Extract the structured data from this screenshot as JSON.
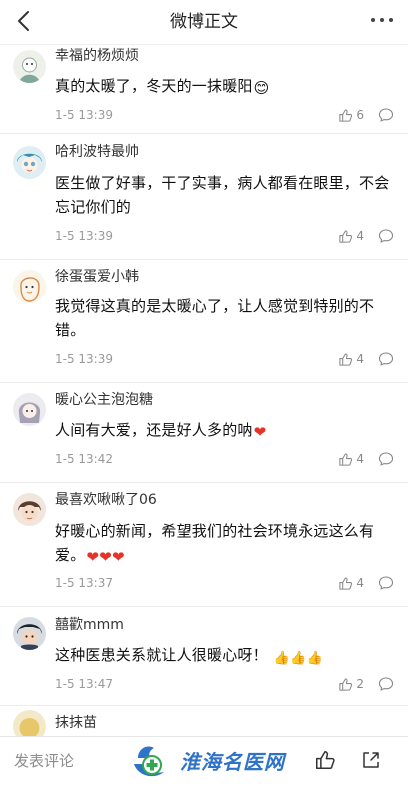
{
  "header": {
    "title": "微博正文",
    "back_icon": "chevron-left-icon",
    "more_icon": "more-dots-icon"
  },
  "comments": [
    {
      "user": "幸福的杨烦烦",
      "text": "真的太暖了，冬天的一抹暖阳",
      "emoji": "😊",
      "time": "1-5 13:39",
      "likes": "6"
    },
    {
      "user": "哈利波特最帅",
      "text": "医生做了好事，干了实事，病人都看在眼里，不会忘记你们的",
      "time": "1-5 13:39",
      "likes": "4"
    },
    {
      "user": "徐蛋蛋爱小韩",
      "text": "我觉得这真的是太暖心了，让人感觉到特别的不错。",
      "time": "1-5 13:39",
      "likes": "4"
    },
    {
      "user": "暖心公主泡泡糖",
      "text": "人间有大爱，还是好人多的呐",
      "emoji": "❤",
      "time": "1-5 13:42",
      "likes": "4"
    },
    {
      "user": "最喜欢啾啾了06",
      "text": "好暖心的新闻，希望我们的社会环境永远这么有爱。",
      "emoji": "❤❤❤",
      "time": "1-5 13:37",
      "likes": "4"
    },
    {
      "user": "囍歡mmm",
      "text": "这种医患关系就让人很暖心呀！",
      "emoji": "👍👍👍",
      "time": "1-5 13:47",
      "likes": "2"
    }
  ],
  "partial_comment": {
    "user": "抹抹苗"
  },
  "footer": {
    "compose_label": "发表评论",
    "like_icon": "thumbs-up-icon",
    "share_icon": "share-icon"
  },
  "watermark": {
    "text": "淮海名医网"
  },
  "colors": {
    "accent_blue": "#2e73c8",
    "heart_red": "#e6332a",
    "meta_gray": "#9a9a9a"
  }
}
